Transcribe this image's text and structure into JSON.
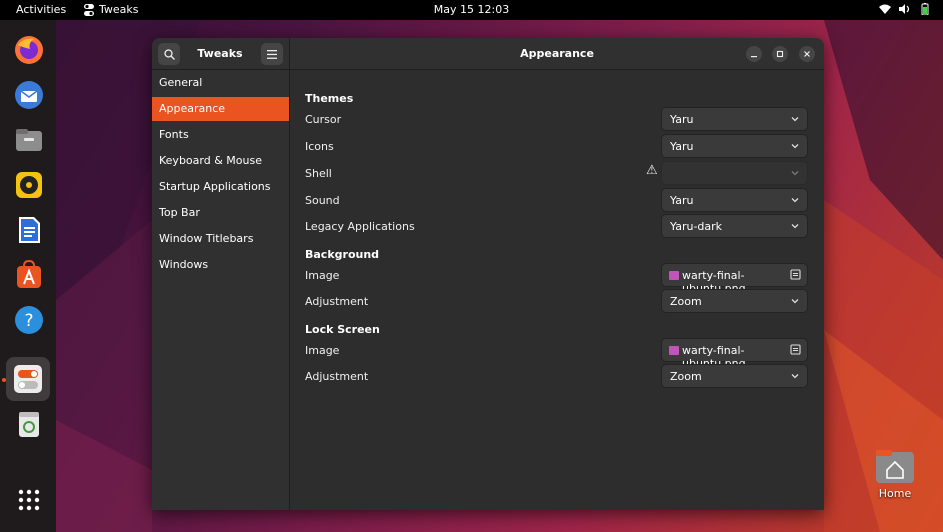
{
  "topbar": {
    "activities": "Activities",
    "app_name": "Tweaks",
    "clock": "May 15  12:03"
  },
  "dock": {
    "items": [
      {
        "name": "Firefox",
        "icon": "firefox-icon",
        "color": "#ff7139"
      },
      {
        "name": "Thunderbird",
        "icon": "thunderbird-icon",
        "color": "#3a7bd5"
      },
      {
        "name": "Files",
        "icon": "files-icon",
        "color": "#8d8d8d"
      },
      {
        "name": "Rhythmbox",
        "icon": "rhythmbox-icon",
        "color": "#f5c211"
      },
      {
        "name": "LibreOffice Writer",
        "icon": "writer-icon",
        "color": "#2a6fdb"
      },
      {
        "name": "Ubuntu Software",
        "icon": "software-icon",
        "color": "#e95420"
      },
      {
        "name": "Help",
        "icon": "help-icon",
        "color": "#2b8fdb"
      },
      {
        "name": "Tweaks",
        "icon": "tweaks-icon",
        "color": "#ececec"
      },
      {
        "name": "Trash",
        "icon": "trash-icon",
        "color": "#3f9b3f"
      }
    ],
    "apps_grid": "show-apps-icon"
  },
  "desktop": {
    "home_label": "Home"
  },
  "window": {
    "left_title": "Tweaks",
    "title": "Appearance",
    "sidebar": [
      "General",
      "Appearance",
      "Fonts",
      "Keyboard & Mouse",
      "Startup Applications",
      "Top Bar",
      "Window Titlebars",
      "Windows"
    ],
    "selected_index": 1,
    "sections": {
      "themes": {
        "title": "Themes",
        "cursor_label": "Cursor",
        "cursor_value": "Yaru",
        "icons_label": "Icons",
        "icons_value": "Yaru",
        "shell_label": "Shell",
        "shell_value": "",
        "sound_label": "Sound",
        "sound_value": "Yaru",
        "legacy_label": "Legacy Applications",
        "legacy_value": "Yaru-dark"
      },
      "background": {
        "title": "Background",
        "image_label": "Image",
        "image_value": "warty-final-ubuntu.png",
        "adjustment_label": "Adjustment",
        "adjustment_value": "Zoom"
      },
      "lock_screen": {
        "title": "Lock Screen",
        "image_label": "Image",
        "image_value": "warty-final-ubuntu.png",
        "adjustment_label": "Adjustment",
        "adjustment_value": "Zoom"
      }
    }
  },
  "colors": {
    "accent": "#e95420",
    "window_bg": "#2d2d2d",
    "sidebar_bg": "#303030"
  }
}
